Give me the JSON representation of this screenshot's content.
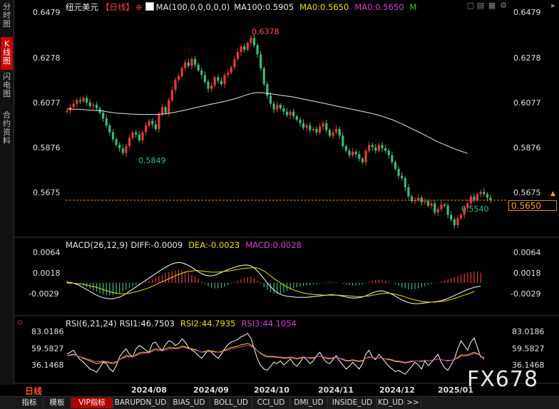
{
  "sidebar": {
    "items": [
      {
        "label": "分时图",
        "active": false
      },
      {
        "label": "K线图",
        "active": true
      },
      {
        "label": "闪电图",
        "active": false
      },
      {
        "label": "合约资料",
        "active": false
      }
    ]
  },
  "header": {
    "symbol": "纽元美元",
    "period": "【日线】",
    "add_symbol": "⊕",
    "ma_label": "MA(100,0,0,0,0,0)",
    "ma100": "MA100:0.5905",
    "ma0_a": "MA0:0.5650",
    "ma0_b": "MA0:0.5650",
    "m_flag": "M"
  },
  "price_axis": {
    "left": [
      "0.6479",
      "0.6278",
      "0.6077",
      "0.5876",
      "0.5675"
    ],
    "right": [
      "0.6479",
      "0.6278",
      "0.6077",
      "0.5876",
      "0.5675"
    ],
    "current": "0.5650",
    "high_label": "0.6378",
    "low_label_1": "0.5849",
    "low_label_2": "0.5540"
  },
  "macd": {
    "legend": "MACD(26,12,9)",
    "diff": "DIFF:-0.0009",
    "dea": "DEA:-0.0023",
    "macd": "MACD:0.0028",
    "axis_left": [
      "0.0064",
      "0.0018",
      "-0.0029"
    ],
    "axis_right": [
      "0.0064",
      "0.0018",
      "-0.0029"
    ]
  },
  "rsi": {
    "legend": "RSI(6,21,24)",
    "rsi1": "RSI1:46.7503",
    "rsi2": "RSI2:44.7935",
    "rsi3": "RSI3:44.1054",
    "axis_left": [
      "83.0186",
      "59.5827",
      "36.1468"
    ],
    "axis_right": [
      "83.0186",
      "59.5827",
      "36.1468"
    ]
  },
  "timeline": {
    "period_label": "日线",
    "dates": [
      "2024/08",
      "2024/09",
      "2024/10",
      "2024/11",
      "2024/12",
      "2025/01"
    ]
  },
  "bottom_tabs": [
    "指标",
    "模板",
    "VIP指标",
    "BARUPDN_UD",
    "BIAS_UD",
    "BOLL_UD",
    "CCI_UD",
    "DMI_UD",
    "INSIDE_UD",
    "KD_UD",
    ">>"
  ],
  "watermark": "FX678",
  "colors": {
    "up": "#e83a3a",
    "down": "#3cba7a",
    "ma100": "#e6e6e6",
    "dea": "#e8e000",
    "macd_text": "#d040d0",
    "current": "#f0a030"
  },
  "chart_data": {
    "type": "candlestick",
    "title": "纽元美元 日线",
    "ylim": [
      0.553,
      0.65
    ],
    "current_price": 0.565,
    "annotated_high": 0.6378,
    "annotated_lows": [
      0.5849,
      0.554
    ],
    "closes": [
      0.6055,
      0.607,
      0.6085,
      0.61,
      0.6095,
      0.611,
      0.609,
      0.6075,
      0.608,
      0.6065,
      0.6045,
      0.602,
      0.599,
      0.596,
      0.593,
      0.5905,
      0.589,
      0.587,
      0.59,
      0.5935,
      0.596,
      0.595,
      0.5925,
      0.596,
      0.599,
      0.601,
      0.5995,
      0.5975,
      0.604,
      0.607,
      0.6045,
      0.61,
      0.6145,
      0.619,
      0.6205,
      0.624,
      0.6265,
      0.625,
      0.628,
      0.6255,
      0.623,
      0.621,
      0.618,
      0.615,
      0.6165,
      0.62,
      0.6185,
      0.617,
      0.621,
      0.622,
      0.6245,
      0.628,
      0.631,
      0.6335,
      0.632,
      0.635,
      0.6372,
      0.634,
      0.63,
      0.624,
      0.617,
      0.612,
      0.6085,
      0.606,
      0.608,
      0.6065,
      0.605,
      0.6035,
      0.605,
      0.603,
      0.6015,
      0.6,
      0.598,
      0.599,
      0.597,
      0.5975,
      0.596,
      0.5985,
      0.6,
      0.597,
      0.5945,
      0.596,
      0.5975,
      0.5945,
      0.59,
      0.588,
      0.586,
      0.5875,
      0.5865,
      0.5845,
      0.583,
      0.588,
      0.5905,
      0.5895,
      0.588,
      0.5905,
      0.589,
      0.588,
      0.586,
      0.583,
      0.58,
      0.577,
      0.576,
      0.572,
      0.568,
      0.566,
      0.5665,
      0.5675,
      0.5655,
      0.566,
      0.564,
      0.565,
      0.561,
      0.5625,
      0.5645,
      0.564,
      0.56,
      0.558,
      0.5555,
      0.5585,
      0.56,
      0.563,
      0.565,
      0.568,
      0.5665,
      0.569,
      0.57,
      0.569,
      0.5675,
      0.5665
    ],
    "ma100": [
      0.6062,
      0.6062,
      0.6061,
      0.6061,
      0.606,
      0.6059,
      0.6058,
      0.6057,
      0.6056,
      0.6055,
      0.6054,
      0.6053,
      0.605,
      0.6048,
      0.6046,
      0.6044,
      0.6043,
      0.6042,
      0.6041,
      0.604,
      0.6039,
      0.6039,
      0.6038,
      0.6038,
      0.6038,
      0.6038,
      0.6038,
      0.6038,
      0.6039,
      0.604,
      0.6041,
      0.6043,
      0.6045,
      0.6048,
      0.6051,
      0.6054,
      0.6057,
      0.606,
      0.6064,
      0.6067,
      0.607,
      0.6073,
      0.6076,
      0.608,
      0.6083,
      0.6086,
      0.6089,
      0.6092,
      0.6095,
      0.6099,
      0.6102,
      0.6106,
      0.611,
      0.6115,
      0.612,
      0.6125,
      0.6129,
      0.6132,
      0.6133,
      0.6133,
      0.6132,
      0.613,
      0.6128,
      0.6126,
      0.6124,
      0.6122,
      0.612,
      0.6118,
      0.6116,
      0.6114,
      0.6111,
      0.6108,
      0.6105,
      0.6102,
      0.6099,
      0.6096,
      0.6093,
      0.609,
      0.6087,
      0.6084,
      0.6081,
      0.6078,
      0.6075,
      0.6072,
      0.6069,
      0.6066,
      0.6063,
      0.606,
      0.6057,
      0.6054,
      0.6051,
      0.6048,
      0.6045,
      0.6042,
      0.6038,
      0.6034,
      0.603,
      0.6025,
      0.602,
      0.6015,
      0.6009,
      0.6003,
      0.5997,
      0.599,
      0.5983,
      0.5976,
      0.5969,
      0.5962,
      0.5955,
      0.5948,
      0.594,
      0.5933,
      0.5925,
      0.5918,
      0.5912,
      0.5906,
      0.59,
      0.5894,
      0.5888,
      0.5883,
      0.5878,
      0.5873,
      0.5868
    ],
    "macd_hist": [
      0.0006,
      0.0004,
      0.0002,
      0.0,
      -0.0004,
      -0.0008,
      -0.0012,
      -0.0016,
      -0.002,
      -0.0024,
      -0.0028,
      -0.0031,
      -0.0033,
      -0.0034,
      -0.0033,
      -0.003,
      -0.0027,
      -0.0023,
      -0.0018,
      -0.0014,
      -0.001,
      -0.0006,
      -0.0003,
      0.0,
      0.0003,
      0.0006,
      0.001,
      0.0014,
      0.0018,
      0.0022,
      0.0026,
      0.0029,
      0.0032,
      0.0034,
      0.0035,
      0.0034,
      0.0031,
      0.0027,
      0.0022,
      0.0017,
      0.0011,
      0.0004,
      -0.0003,
      -0.0009,
      -0.0013,
      -0.0015,
      -0.0015,
      -0.0013,
      -0.001,
      -0.0006,
      -0.0002,
      0.0002,
      0.0006,
      0.001,
      0.0013,
      0.0015,
      0.0016,
      0.0012,
      0.0006,
      -0.0002,
      -0.0011,
      -0.0019,
      -0.0025,
      -0.0029,
      -0.003,
      -0.0029,
      -0.0026,
      -0.0022,
      -0.0018,
      -0.0015,
      -0.0012,
      -0.001,
      -0.0008,
      -0.0007,
      -0.0006,
      -0.0004,
      -0.0003,
      -0.0001,
      0.0001,
      0.0002,
      0.0003,
      0.0002,
      0.0001,
      0.0,
      -0.0002,
      -0.0004,
      -0.0006,
      -0.0007,
      -0.0007,
      -0.0006,
      -0.0004,
      -0.0001,
      0.0003,
      0.0006,
      0.0008,
      0.0009,
      0.0008,
      0.0006,
      0.0003,
      0.0,
      -0.0004,
      -0.0008,
      -0.0012,
      -0.0015,
      -0.0017,
      -0.0018,
      -0.0017,
      -0.0015,
      -0.0012,
      -0.0009,
      -0.0006,
      -0.0003,
      -0.0001,
      0.0001,
      0.0004,
      0.0007,
      0.001,
      0.0013,
      0.0016,
      0.0019,
      0.0022,
      0.0025,
      0.0028,
      0.003,
      0.0031,
      0.003,
      0.0028
    ],
    "diff": [
      0.0002,
      0.0001,
      -0.0001,
      -0.0004,
      -0.0008,
      -0.0013,
      -0.0018,
      -0.0023,
      -0.0028,
      -0.0033,
      -0.0037,
      -0.004,
      -0.0042,
      -0.0043,
      -0.0043,
      -0.0041,
      -0.0038,
      -0.0034,
      -0.0029,
      -0.0023,
      -0.0017,
      -0.0011,
      -0.0005,
      0.0001,
      0.0007,
      0.0013,
      0.0019,
      0.0025,
      0.0031,
      0.0037,
      0.0042,
      0.0047,
      0.0051,
      0.0054,
      0.0055,
      0.0054,
      0.0051,
      0.0047,
      0.0042,
      0.0036,
      0.003,
      0.0025,
      0.0021,
      0.0019,
      0.0019,
      0.0021,
      0.0024,
      0.0028,
      0.0032,
      0.0036,
      0.0039,
      0.0042,
      0.0045,
      0.0047,
      0.0048,
      0.0048,
      0.0046,
      0.004,
      0.0032,
      0.0022,
      0.0011,
      0.0,
      -0.001,
      -0.0019,
      -0.0026,
      -0.0031,
      -0.0034,
      -0.0036,
      -0.0037,
      -0.0038,
      -0.0039,
      -0.0039,
      -0.0039,
      -0.0039,
      -0.0038,
      -0.0037,
      -0.0036,
      -0.0035,
      -0.0034,
      -0.0033,
      -0.0032,
      -0.0032,
      -0.0033,
      -0.0034,
      -0.0036,
      -0.0038,
      -0.004,
      -0.0041,
      -0.0041,
      -0.004,
      -0.0038,
      -0.0035,
      -0.0031,
      -0.0027,
      -0.0024,
      -0.0022,
      -0.0022,
      -0.0024,
      -0.0027,
      -0.0031,
      -0.0036,
      -0.0041,
      -0.0046,
      -0.005,
      -0.0053,
      -0.0055,
      -0.0056,
      -0.0056,
      -0.0055,
      -0.0054,
      -0.0053,
      -0.0052,
      -0.0051,
      -0.005,
      -0.0048,
      -0.0045,
      -0.0042,
      -0.0038,
      -0.0034,
      -0.003,
      -0.0026,
      -0.0022,
      -0.0018,
      -0.0015,
      -0.0012,
      -0.001,
      -0.0009
    ],
    "dea": [
      0.0,
      -0.0001,
      -0.0001,
      -0.0002,
      -0.0003,
      -0.0004,
      -0.0006,
      -0.0008,
      -0.001,
      -0.0012,
      -0.0015,
      -0.0018,
      -0.0021,
      -0.0024,
      -0.0026,
      -0.0028,
      -0.0029,
      -0.0029,
      -0.0029,
      -0.0028,
      -0.0026,
      -0.0024,
      -0.0022,
      -0.0019,
      -0.0016,
      -0.0013,
      -0.0009,
      -0.0005,
      -0.0001,
      0.0003,
      0.0007,
      0.0011,
      0.0015,
      0.0019,
      0.0023,
      0.0026,
      0.0029,
      0.0031,
      0.0032,
      0.0033,
      0.0033,
      0.0032,
      0.0031,
      0.003,
      0.0029,
      0.0029,
      0.0029,
      0.003,
      0.0031,
      0.0032,
      0.0033,
      0.0035,
      0.0036,
      0.0038,
      0.0039,
      0.004,
      0.0041,
      0.0041,
      0.004,
      0.0037,
      0.0032,
      0.0026,
      0.0019,
      0.0012,
      0.0006,
      0.0,
      -0.0006,
      -0.0011,
      -0.0015,
      -0.0019,
      -0.0022,
      -0.0025,
      -0.0027,
      -0.0029,
      -0.003,
      -0.0031,
      -0.0032,
      -0.0032,
      -0.0033,
      -0.0033,
      -0.0033,
      -0.0033,
      -0.0033,
      -0.0033,
      -0.0034,
      -0.0034,
      -0.0035,
      -0.0036,
      -0.0037,
      -0.0037,
      -0.0037,
      -0.0036,
      -0.0035,
      -0.0033,
      -0.0032,
      -0.003,
      -0.0029,
      -0.0028,
      -0.0028,
      -0.0029,
      -0.0031,
      -0.0033,
      -0.0035,
      -0.0038,
      -0.0041,
      -0.0044,
      -0.0046,
      -0.0048,
      -0.005,
      -0.0051,
      -0.0052,
      -0.0052,
      -0.0052,
      -0.0051,
      -0.005,
      -0.0049,
      -0.0047,
      -0.0045,
      -0.0042,
      -0.0039,
      -0.0036,
      -0.0033,
      -0.003,
      -0.0027,
      -0.0023
    ],
    "rsi1": [
      52,
      55,
      58,
      50,
      44,
      40,
      35,
      30,
      28,
      25,
      32,
      40,
      38,
      30,
      26,
      35,
      48,
      55,
      60,
      52,
      48,
      60,
      65,
      62,
      58,
      55,
      68,
      70,
      62,
      58,
      66,
      72,
      70,
      65,
      68,
      75,
      70,
      62,
      58,
      55,
      50,
      46,
      52,
      58,
      55,
      50,
      46,
      52,
      60,
      66,
      70,
      72,
      74,
      78,
      80,
      83,
      76,
      60,
      45,
      35,
      30,
      28,
      34,
      40,
      38,
      42,
      36,
      40,
      45,
      38,
      34,
      40,
      48,
      44,
      38,
      42,
      50,
      55,
      46,
      40,
      38,
      44,
      50,
      42,
      36,
      30,
      34,
      40,
      35,
      30,
      38,
      52,
      58,
      48,
      44,
      52,
      46,
      40,
      34,
      30,
      26,
      28,
      25,
      22,
      28,
      34,
      40,
      36,
      30,
      42,
      35,
      40,
      46,
      52,
      40,
      32,
      28,
      36,
      45,
      60,
      72,
      65,
      58,
      70,
      76,
      62,
      48,
      47
    ],
    "rsi2": [
      50,
      51,
      52,
      50,
      48,
      46,
      44,
      42,
      40,
      38,
      39,
      41,
      40,
      39,
      38,
      40,
      44,
      47,
      50,
      49,
      48,
      51,
      54,
      55,
      55,
      55,
      58,
      60,
      59,
      58,
      60,
      62,
      62,
      61,
      62,
      64,
      63,
      61,
      60,
      59,
      57,
      55,
      56,
      57,
      57,
      56,
      55,
      56,
      58,
      60,
      62,
      63,
      64,
      66,
      67,
      68,
      66,
      62,
      57,
      53,
      50,
      48,
      48,
      48,
      47,
      47,
      46,
      46,
      47,
      46,
      45,
      46,
      48,
      47,
      46,
      46,
      48,
      49,
      48,
      46,
      45,
      46,
      47,
      46,
      44,
      42,
      42,
      43,
      42,
      41,
      42,
      46,
      48,
      47,
      46,
      47,
      46,
      45,
      44,
      43,
      41,
      41,
      40,
      39,
      40,
      41,
      42,
      42,
      41,
      43,
      42,
      43,
      44,
      45,
      44,
      43,
      42,
      43,
      44,
      47,
      51,
      51,
      51,
      53,
      55,
      53,
      50,
      45
    ],
    "rsi3": [
      50,
      50,
      51,
      50,
      48,
      47,
      45,
      44,
      42,
      41,
      41,
      42,
      41,
      40,
      40,
      41,
      44,
      46,
      48,
      48,
      48,
      50,
      52,
      53,
      54,
      54,
      56,
      58,
      57,
      57,
      58,
      60,
      60,
      60,
      60,
      62,
      62,
      60,
      59,
      58,
      57,
      55,
      55,
      56,
      56,
      55,
      55,
      55,
      57,
      58,
      60,
      61,
      62,
      63,
      64,
      65,
      64,
      61,
      57,
      54,
      51,
      49,
      49,
      49,
      48,
      48,
      47,
      47,
      48,
      47,
      46,
      47,
      48,
      47,
      47,
      47,
      48,
      49,
      48,
      47,
      46,
      47,
      47,
      46,
      45,
      43,
      43,
      44,
      43,
      42,
      43,
      46,
      47,
      47,
      46,
      47,
      46,
      45,
      45,
      44,
      42,
      42,
      41,
      40,
      41,
      42,
      42,
      42,
      42,
      43,
      42,
      43,
      44,
      45,
      44,
      43,
      43,
      43,
      44,
      46,
      49,
      49,
      50,
      51,
      53,
      52,
      50,
      44
    ]
  }
}
